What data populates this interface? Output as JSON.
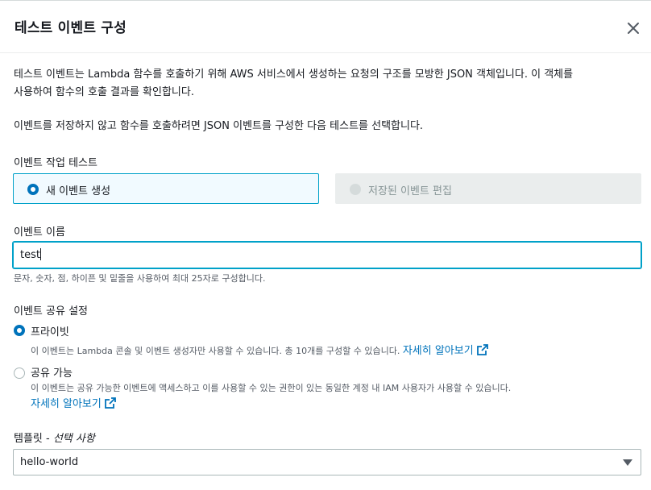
{
  "dialog": {
    "title": "테스트 이벤트 구성"
  },
  "intro": {
    "line1": "테스트 이벤트는 Lambda 함수를 호출하기 위해 AWS 서비스에서 생성하는 요청의 구조를 모방한 JSON 객체입니다. 이 객체를",
    "line2": "사용하여 함수의 호출 결과를 확인합니다.",
    "line3": "이벤트를 저장하지 않고 함수를 호출하려면 JSON 이벤트를 구성한 다음 테스트를 선택합니다."
  },
  "event_action": {
    "label": "이벤트 작업 테스트",
    "options": [
      {
        "label": "새 이벤트 생성",
        "selected": true,
        "disabled": false
      },
      {
        "label": "저장된 이벤트 편집",
        "selected": false,
        "disabled": true
      }
    ]
  },
  "event_name": {
    "label": "이벤트 이름",
    "value": "test",
    "hint": "문자, 숫자, 점, 하이픈 및 밑줄을 사용하여 최대 25자로 구성합니다."
  },
  "sharing": {
    "label": "이벤트 공유 설정",
    "options": [
      {
        "label": "프라이빗",
        "selected": true,
        "description": "이 이벤트는 Lambda 콘솔 및 이벤트 생성자만 사용할 수 있습니다. 총 10개를 구성할 수 있습니다.",
        "link": "자세히 알아보기"
      },
      {
        "label": "공유 가능",
        "selected": false,
        "description": "이 이벤트는 공유 가능한 이벤트에 액세스하고 이를 사용할 수 있는 권한이 있는 동일한 계정 내 IAM 사용자가 사용할 수 있습니다.",
        "link": "자세히 알아보기"
      }
    ]
  },
  "template": {
    "label": "템플릿 - ",
    "label_optional": "선택 사항",
    "value": "hello-world"
  },
  "colors": {
    "accent": "#0073bb",
    "focus_border": "#00a1c9"
  },
  "icons": {
    "close": "close-icon",
    "external": "external-link-icon",
    "caret": "caret-down-icon"
  }
}
